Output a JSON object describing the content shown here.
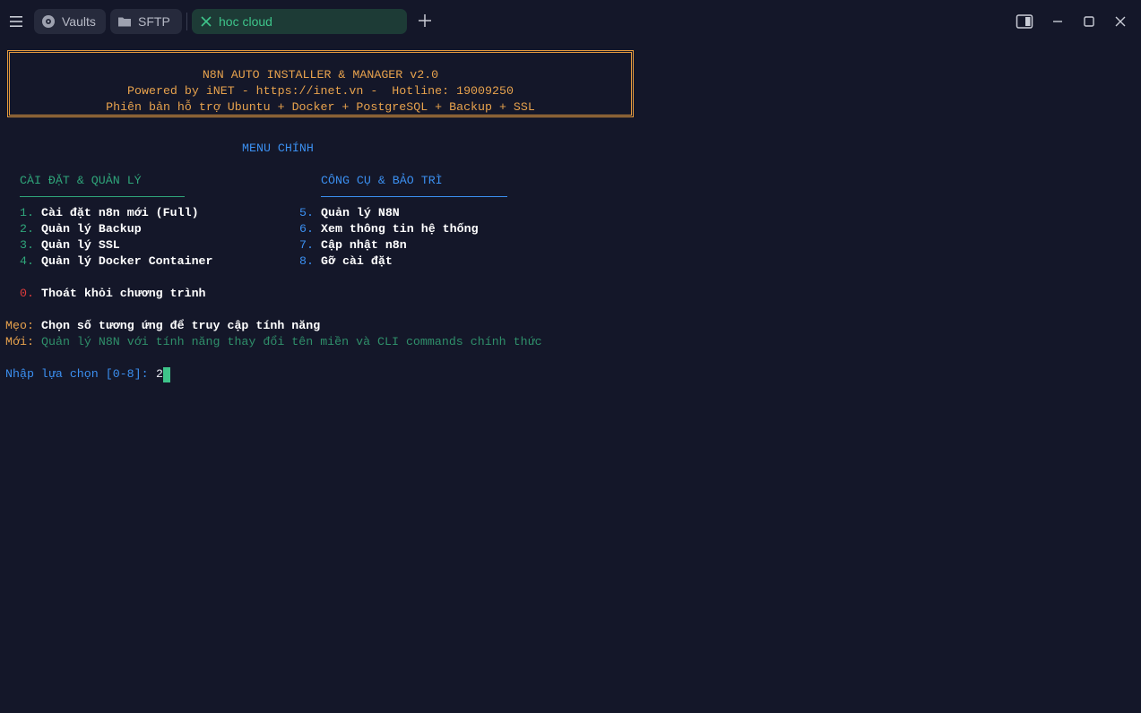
{
  "tabs": [
    {
      "label": "Vaults",
      "icon": "vault-icon"
    },
    {
      "label": "SFTP",
      "icon": "folder-icon"
    },
    {
      "label": "hoc cloud",
      "icon": "close-icon",
      "active": true
    }
  ],
  "terminal": {
    "banner": {
      "line1": "N8N AUTO INSTALLER & MANAGER v2.0",
      "line2": "Powered by iNET - https://inet.vn -  Hotline: 19009250",
      "line3": "Phiên bản hỗ trợ Ubuntu + Docker + PostgreSQL + Backup + SSL"
    },
    "menu_title": "MENU CHÍNH",
    "section_left": "CÀI ĐẶT & QUẢN LÝ",
    "section_right": "CÔNG CỤ & BẢO TRÌ",
    "left_items": [
      {
        "num": "1.",
        "label": "Cài đặt n8n mới (Full)"
      },
      {
        "num": "2.",
        "label": "Quản lý Backup"
      },
      {
        "num": "3.",
        "label": "Quản lý SSL"
      },
      {
        "num": "4.",
        "label": "Quản lý Docker Container"
      }
    ],
    "right_items": [
      {
        "num": "5.",
        "label": "Quản lý N8N"
      },
      {
        "num": "6.",
        "label": "Xem thông tin hệ thống"
      },
      {
        "num": "7.",
        "label": "Cập nhật n8n"
      },
      {
        "num": "8.",
        "label": "Gỡ cài đặt"
      }
    ],
    "exit_item": {
      "num": "0.",
      "label": "Thoát khỏi chương trình"
    },
    "tip": {
      "label": "Mẹo:",
      "text": "Chọn số tương ứng để truy cập tính năng"
    },
    "new": {
      "label": "Mới:",
      "text": "Quản lý N8N với tính năng thay đổi tên miền và CLI commands chính thức"
    },
    "prompt": {
      "label": "Nhập lựa chọn [0-8]:",
      "value": "2"
    }
  },
  "colors": {
    "background": "#141729",
    "accent_green": "#3ec48a",
    "banner_orange": "#e7a24d",
    "menu_blue": "#3b8ff0",
    "exit_red": "#e03c3c"
  }
}
